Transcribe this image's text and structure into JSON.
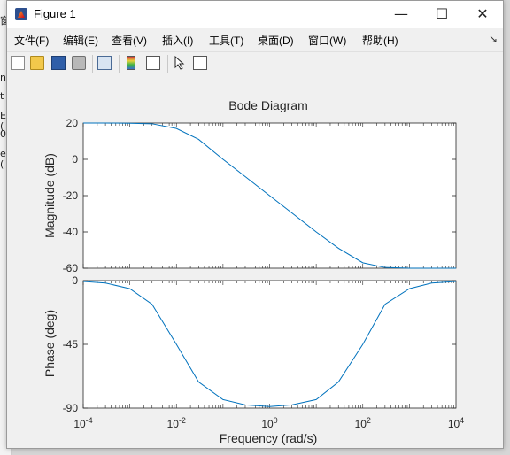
{
  "window": {
    "title": "Figure 1",
    "minimize_glyph": "—",
    "maximize_glyph": "☐",
    "close_glyph": "✕"
  },
  "background_app": {
    "glyphs": [
      "窗",
      "n",
      "t",
      "E (",
      "0",
      "e ("
    ]
  },
  "menu": {
    "items": [
      "文件(F)",
      "编辑(E)",
      "查看(V)",
      "插入(I)",
      "工具(T)",
      "桌面(D)",
      "窗口(W)",
      "帮助(H)"
    ],
    "overflow_glyph": "↘"
  },
  "toolbar": {
    "icons": [
      "new-figure-icon",
      "open-file-icon",
      "save-icon",
      "print-icon",
      "link-plot-icon",
      "insert-colorbar-icon",
      "insert-legend-icon",
      "pointer-icon",
      "property-inspector-icon"
    ]
  },
  "chart_data": {
    "type": "line",
    "title": "Bode Diagram",
    "xlabel": "Frequency  (rad/s)",
    "xscale": "log",
    "xlim": [
      0.0001,
      10000
    ],
    "xticks": [
      "10-4",
      "10-2",
      "100",
      "102",
      "104"
    ],
    "color": "#0072bd",
    "magnitude": {
      "ylabel": "Magnitude (dB)",
      "ylim": [
        -60,
        20
      ],
      "yticks": [
        "20",
        "0",
        "-20",
        "-40",
        "-60"
      ],
      "series": [
        {
          "x": [
            0.0001,
            0.0003,
            0.001,
            0.003,
            0.01,
            0.03,
            0.1,
            0.3,
            1,
            3,
            10,
            30,
            100,
            300,
            1000,
            3000,
            10000
          ],
          "values": [
            20.0,
            20.0,
            19.9,
            19.6,
            17.0,
            11.0,
            0.0,
            -9.5,
            -20.0,
            -29.5,
            -40.0,
            -49.0,
            -57.0,
            -59.6,
            -60.0,
            -60.0,
            -60.0
          ]
        }
      ]
    },
    "phase": {
      "ylabel": "Phase (deg)",
      "ylim": [
        -90,
        0
      ],
      "yticks": [
        "0",
        "-45",
        "-90"
      ],
      "series": [
        {
          "x": [
            0.0001,
            0.0003,
            0.001,
            0.003,
            0.01,
            0.03,
            0.1,
            0.3,
            1,
            3,
            10,
            30,
            100,
            300,
            1000,
            3000,
            10000
          ],
          "values": [
            -0.6,
            -1.7,
            -5.7,
            -16.7,
            -45.0,
            -71.6,
            -84.0,
            -87.7,
            -88.9,
            -87.7,
            -84.0,
            -71.6,
            -45.0,
            -16.7,
            -5.7,
            -1.7,
            -0.6
          ]
        }
      ]
    },
    "grid": false
  }
}
